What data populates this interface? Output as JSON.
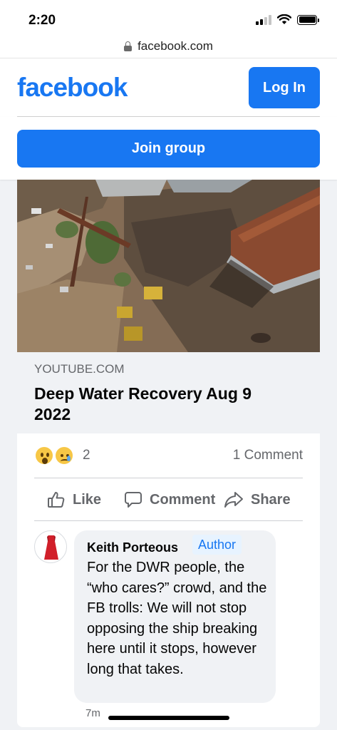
{
  "status_bar": {
    "time": "2:20"
  },
  "browser": {
    "url": "facebook.com"
  },
  "header": {
    "logo": "facebook",
    "login_label": "Log In"
  },
  "group": {
    "join_label": "Join group"
  },
  "post": {
    "link_domain": "YOUTUBE.COM",
    "link_title": "Deep Water Recovery Aug 9 2022",
    "reaction_icons": [
      "wow-reaction-icon",
      "sad-reaction-icon"
    ],
    "reaction_count": "2",
    "comment_count": "1 Comment",
    "actions": {
      "like": "Like",
      "comment": "Comment",
      "share": "Share"
    }
  },
  "comment": {
    "author": "Keith Porteous",
    "badge": "Author",
    "text": "For the DWR people, the “who cares?” crowd, and the FB trolls: We will not stop opposing the ship breaking here until it stops, however long that takes.",
    "time": "7m"
  },
  "colors": {
    "brand": "#1877f2",
    "secondary_text": "#65676b",
    "page_bg": "#f0f2f5"
  }
}
